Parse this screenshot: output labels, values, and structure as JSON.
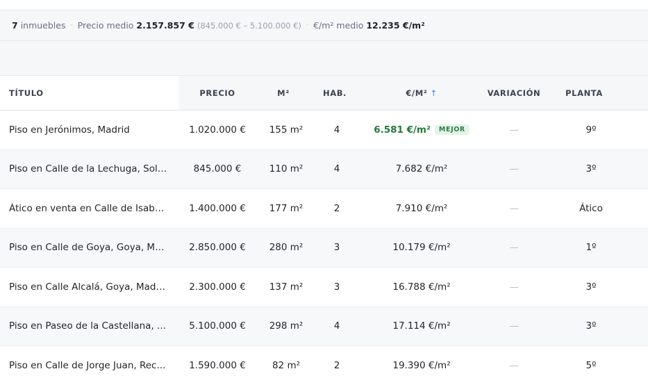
{
  "summary": {
    "count": "7",
    "count_label": "inmuebles",
    "avg_price_label": "Precio medio",
    "avg_price": "2.157.857 €",
    "range": "(845.000 € – 5.100.000 €)",
    "avg_eur_m2_label": "€/m² medio",
    "avg_eur_m2": "12.235 €/m²"
  },
  "columns": {
    "title": "TÍTULO",
    "price": "PRECIO",
    "m2": "M²",
    "hab": "HAB.",
    "eur_m2": "€/M²",
    "variation": "VARIACIÓN",
    "planta": "PLANTA"
  },
  "sort": {
    "column": "€/M²",
    "direction": "asc",
    "icon": "arrow-up-icon",
    "glyph": "↑"
  },
  "best_badge": "MEJOR",
  "variation_placeholder": "—",
  "rows": [
    {
      "title": "Piso en Jerónimos, Madrid",
      "price": "1.020.000 €",
      "m2": "155 m²",
      "hab": "4",
      "eur_m2": "6.581 €/m²",
      "variation": "—",
      "planta": "9º"
    },
    {
      "title": "Piso en Calle de la Lechuga, Sol, ...",
      "price": "845.000 €",
      "m2": "110 m²",
      "hab": "4",
      "eur_m2": "7.682 €/m²",
      "variation": "—",
      "planta": "3º"
    },
    {
      "title": "Ático en venta en Calle de Isabe...",
      "price": "1.400.000 €",
      "m2": "177 m²",
      "hab": "2",
      "eur_m2": "7.910 €/m²",
      "variation": "—",
      "planta": "Ático"
    },
    {
      "title": "Piso en Calle de Goya, Goya, Ma...",
      "price": "2.850.000 €",
      "m2": "280 m²",
      "hab": "3",
      "eur_m2": "10.179 €/m²",
      "variation": "—",
      "planta": "1º"
    },
    {
      "title": "Piso en Calle Alcalá, Goya, Madrid",
      "price": "2.300.000 €",
      "m2": "137 m²",
      "hab": "3",
      "eur_m2": "16.788 €/m²",
      "variation": "—",
      "planta": "3º"
    },
    {
      "title": "Piso en Paseo de la Castellana, ...",
      "price": "5.100.000 €",
      "m2": "298 m²",
      "hab": "4",
      "eur_m2": "17.114 €/m²",
      "variation": "—",
      "planta": "3º"
    },
    {
      "title": "Piso en Calle de Jorge Juan, Rec...",
      "price": "1.590.000 €",
      "m2": "82 m²",
      "hab": "2",
      "eur_m2": "19.390 €/m²",
      "variation": "—",
      "planta": "5º"
    }
  ],
  "colors": {
    "best_value": "#1f7a3a",
    "best_badge_bg": "#e3f4e8",
    "sort_arrow": "#2f7ff5"
  }
}
